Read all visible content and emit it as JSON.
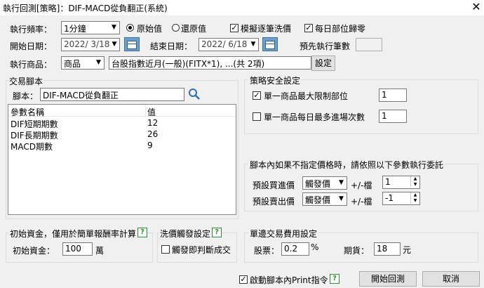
{
  "window": {
    "title": "執行回測[策略]：DIF-MACD從負翻正(系統)",
    "close_glyph": "✕"
  },
  "top": {
    "freq_label": "執行頻率：",
    "freq_value": "1分鐘",
    "radio_original": "原始值",
    "radio_restored": "還原值",
    "chk_simulate": "模擬逐筆洗價",
    "chk_daily_reset": "每日部位歸零",
    "start_label": "開始日期：",
    "start_value": "2022/ 3/18",
    "end_label": "結束日期：",
    "end_value": "2022/ 6/18",
    "prefetch_label": "預先執行筆數",
    "product_label": "執行商品：",
    "product_type": "商品",
    "product_desc": "台股指數近月(一般)(FITX*1), ...(共 2項)",
    "set_button": "設定"
  },
  "script_group": {
    "title": "交易腳本",
    "script_label": "腳本：",
    "script_value": "DIF-MACD從負翻正",
    "col_name": "參數名稱",
    "col_value": "值",
    "params": [
      {
        "name": "DIF短期期數",
        "value": "12"
      },
      {
        "name": "DIF長期期數",
        "value": "26"
      },
      {
        "name": "MACD期數",
        "value": "9"
      }
    ]
  },
  "safety_group": {
    "title": "策略安全設定",
    "max_position_label": "單一商品最大限制部位",
    "max_position_value": "1",
    "max_entries_label": "單一商品每日最多進場次數",
    "max_entries_value": "1"
  },
  "order_group": {
    "title": "腳本內如果不指定價格時，請依照以下參數執行委託",
    "buy_label": "預設買進價",
    "buy_type": "觸發價",
    "buy_tick_label": "+/-檔",
    "buy_tick_value": "1",
    "sell_label": "預設賣出價",
    "sell_type": "觸發價",
    "sell_tick_label": "+/-檔",
    "sell_tick_value": "-1"
  },
  "capital_group": {
    "title": "初始資金，僅用於簡單報酬率計算",
    "capital_label": "初始資金：",
    "capital_value": "100",
    "capital_unit": "萬"
  },
  "wash_group": {
    "title": "洗價觸發設定",
    "trigger_label": "觸發即判斷成交"
  },
  "fee_group": {
    "title": "單邊交易費用設定",
    "stock_label": "股票：",
    "stock_value": "0.2",
    "stock_unit": "%",
    "futures_label": "期貨：",
    "futures_value": "18",
    "futures_unit": "元"
  },
  "bottom": {
    "print_label": "啟動腳本內Print指令",
    "start_button": "開始回測",
    "cancel_button": "取消"
  },
  "glyphs": {
    "dropdown": "▼",
    "check": "✓",
    "help": "?",
    "spin_up": "▲",
    "spin_down": "▼"
  }
}
